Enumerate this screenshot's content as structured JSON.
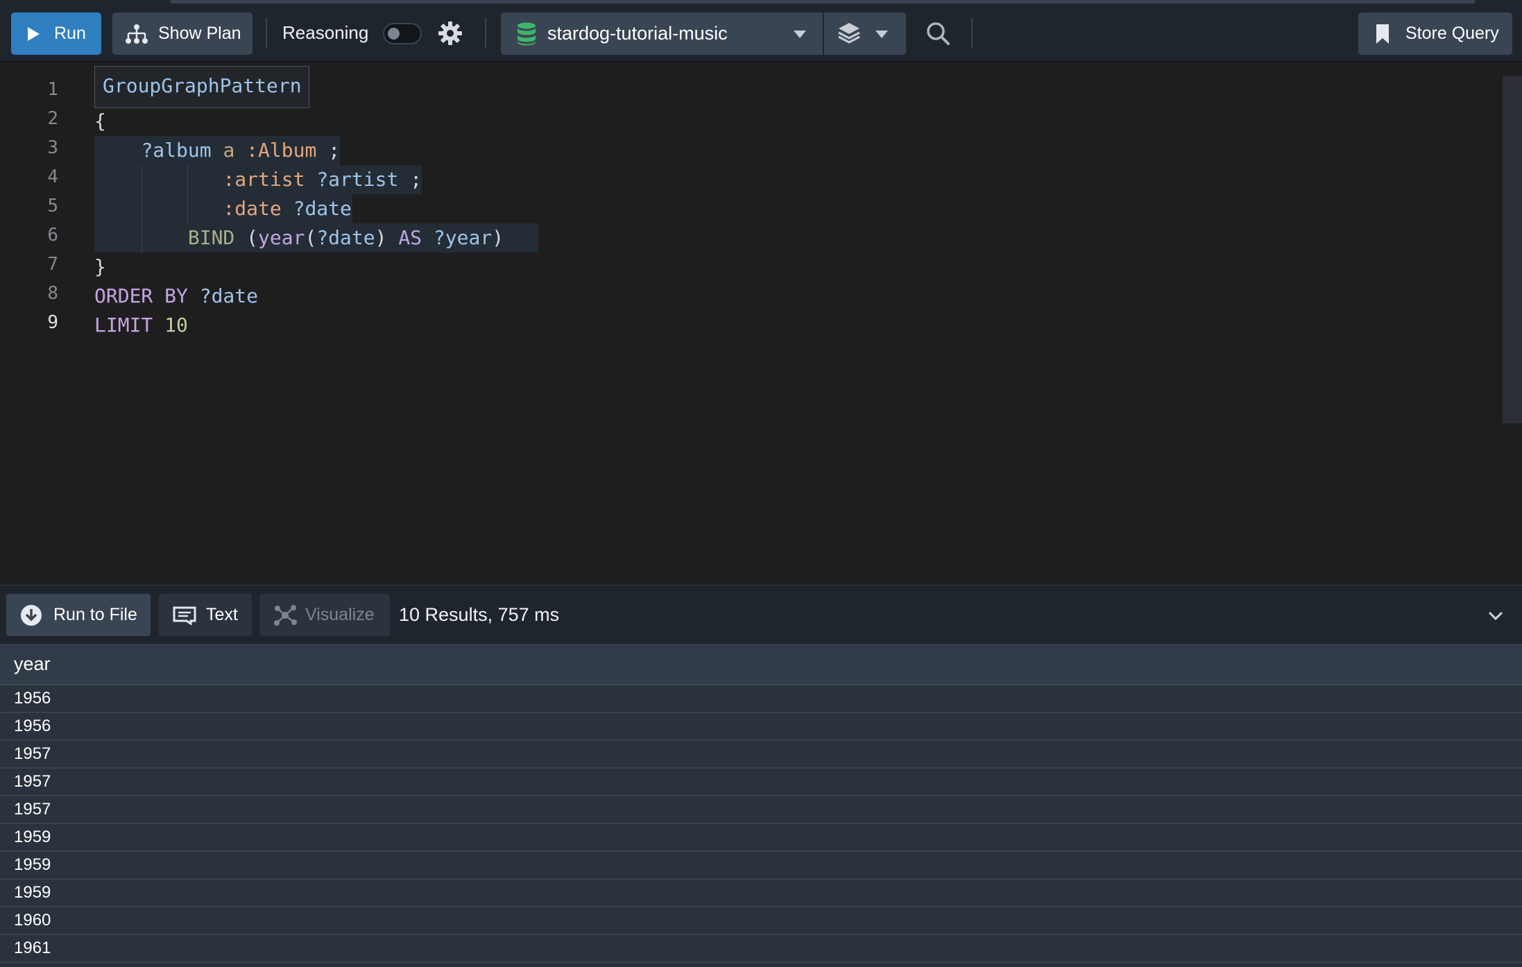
{
  "toolbar": {
    "run_label": "Run",
    "show_plan_label": "Show Plan",
    "reasoning_label": "Reasoning",
    "reasoning_enabled": false,
    "database": "stardog-tutorial-music",
    "store_query_label": "Store Query"
  },
  "editor": {
    "tooltip": "GroupGraphPattern",
    "line_numbers": [
      "1",
      "2",
      "3",
      "4",
      "5",
      "6",
      "7",
      "8",
      "9"
    ],
    "active_line": "9"
  },
  "results": {
    "run_to_file_label": "Run to File",
    "text_label": "Text",
    "visualize_label": "Visualize",
    "summary": "10 Results,  757 ms",
    "column": "year",
    "rows": [
      "1956",
      "1956",
      "1957",
      "1957",
      "1957",
      "1959",
      "1959",
      "1959",
      "1960",
      "1961"
    ]
  },
  "icons": [
    "play-icon",
    "plan-icon",
    "gear-icon",
    "database-icon",
    "chevron-down-icon",
    "layers-icon",
    "search-icon",
    "bookmark-icon",
    "download-icon",
    "text-icon",
    "visualize-icon"
  ],
  "colors": {
    "accent": "#2f7fc1",
    "database_icon": "#3fb56b",
    "editor_background": "#1e1e1e",
    "toolbar_background": "#1f252d"
  }
}
